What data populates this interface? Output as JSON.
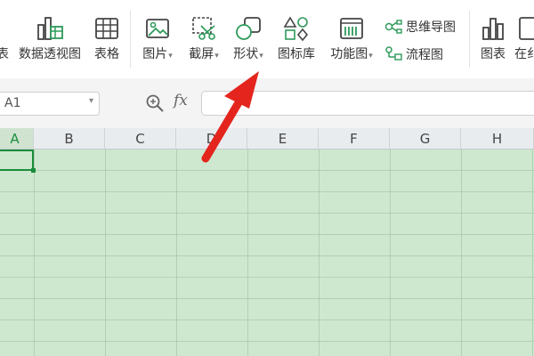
{
  "ribbon": {
    "cut_left_label": "表",
    "pivot_label": "数据透视图",
    "table_label": "表格",
    "picture_label": "图片",
    "screenshot_label": "截屏",
    "shape_label": "形状",
    "iconlib_label": "图标库",
    "funcchart_label": "功能图",
    "mindmap_label": "思维导图",
    "flowchart_label": "流程图",
    "chart_label": "图表",
    "cut_right_label": "在纟"
  },
  "formula_bar": {
    "name_box": "A1",
    "fx_label": "fx"
  },
  "columns": [
    "A",
    "B",
    "C",
    "D",
    "E",
    "F",
    "G",
    "H"
  ],
  "colors": {
    "grid_background": "#cde8cf",
    "selection_border": "#1a8c3a",
    "arrow": "#e3251d",
    "icon_green": "#2e9a5a"
  }
}
